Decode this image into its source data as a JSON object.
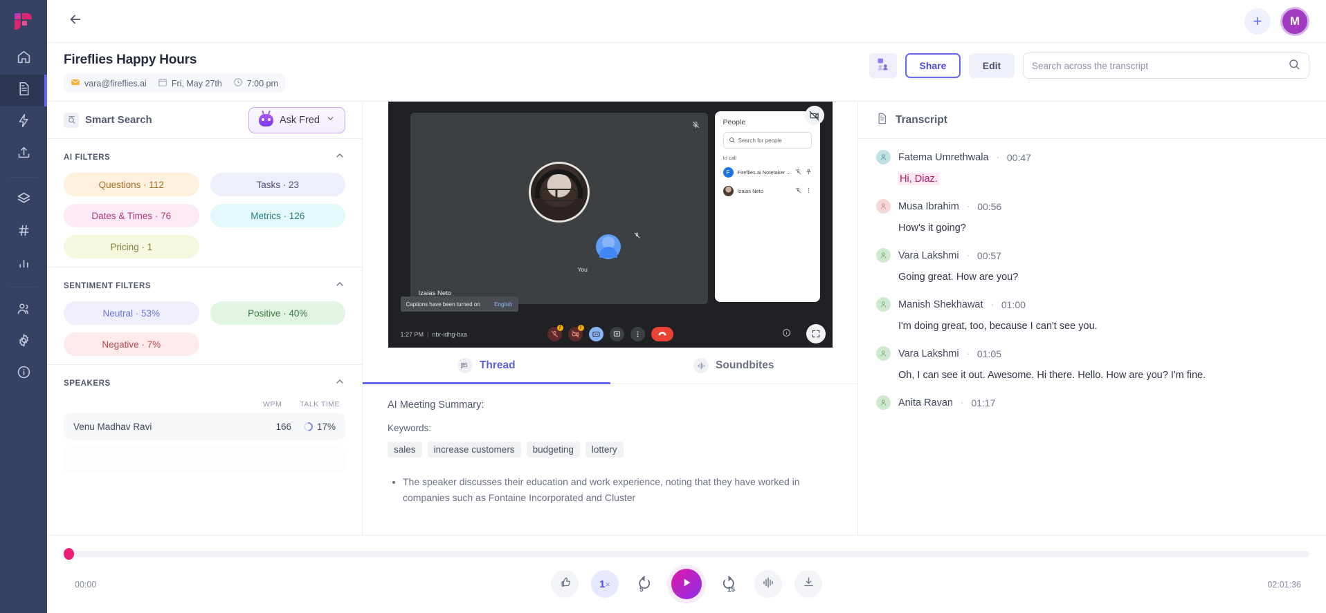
{
  "brand": {
    "logo_name": "fireflies-logo",
    "accent": "#6366f1",
    "pink": "#ec1e79"
  },
  "rail": {
    "items": [
      {
        "name": "home",
        "icon": "home-icon",
        "active": false
      },
      {
        "name": "notes",
        "icon": "document-icon",
        "active": true
      },
      {
        "name": "automation",
        "icon": "lightning-icon",
        "active": false
      },
      {
        "name": "upload",
        "icon": "upload-icon",
        "active": false
      },
      {
        "name": "channels",
        "icon": "layers-icon",
        "active": false
      },
      {
        "name": "topics",
        "icon": "hash-icon",
        "active": false
      },
      {
        "name": "analytics",
        "icon": "bar-chart-icon",
        "active": false
      },
      {
        "name": "teammates",
        "icon": "users-icon",
        "active": false
      },
      {
        "name": "settings",
        "icon": "gear-icon",
        "active": false
      },
      {
        "name": "help",
        "icon": "info-icon",
        "active": false
      }
    ]
  },
  "topbar": {
    "back_icon": "arrow-left-icon",
    "plus_label": "+",
    "avatar_initial": "M"
  },
  "meeting": {
    "title": "Fireflies Happy Hours",
    "organizer": "vara@fireflies.ai",
    "date": "Fri, May 27th",
    "time": "7:00 pm",
    "share_label": "Share",
    "edit_label": "Edit",
    "invite_icon": "add-participants-icon"
  },
  "search": {
    "placeholder": "Search across the transcript",
    "value": "",
    "icon": "search-icon"
  },
  "smart_search": {
    "label": "Smart Search",
    "icon": "smart-search-icon",
    "ask_fred_label": "Ask Fred",
    "chevron": "chevron-down-icon"
  },
  "ai_filters": {
    "title": "AI FILTERS",
    "collapsed": false,
    "chips": [
      {
        "label": "Questions · 112",
        "bg": "#fdf0dd",
        "fg": "#a8702a"
      },
      {
        "label": "Tasks · 23",
        "bg": "#eeeffc",
        "fg": "#4a5striped"
      },
      {
        "label": "Dates & Times · 76",
        "bg": "#fdeaf4",
        "fg": "#a93a7e"
      },
      {
        "label": "Metrics · 126",
        "bg": "#e3f8f8",
        "fg": "#2e7c80"
      },
      {
        "label": "Pricing · 1",
        "bg": "#f6f7df",
        "fg": "#7d7f3a"
      }
    ]
  },
  "sentiment_filters": {
    "title": "SENTIMENT FILTERS",
    "collapsed": false,
    "chips": [
      {
        "label": "Neutral · 53%",
        "bg": "#eeeefc",
        "fg": "#6f76d8"
      },
      {
        "label": "Positive · 40%",
        "bg": "#e2f4e4",
        "fg": "#3b7a43"
      },
      {
        "label": "Negative · 7%",
        "bg": "#fdeaea",
        "fg": "#b3484a"
      }
    ]
  },
  "speakers": {
    "title": "SPEAKERS",
    "collapsed": false,
    "col_wpm": "WPM",
    "col_talk": "TALK TIME",
    "rows": [
      {
        "name": "Venu Madhav Ravi",
        "wpm": "166",
        "talk": "17%"
      }
    ]
  },
  "video": {
    "participant_name": "Izaias Neto",
    "self_label": "You",
    "caption_text": "Captions have been turned on",
    "caption_lang": "English",
    "clock": "1:27 PM",
    "meeting_code": "nbr-idhg-bxa",
    "people_panel": {
      "title": "People",
      "search_placeholder": "Search for people",
      "section": "In call",
      "rows": [
        {
          "initial": "F",
          "name": "Fireflies.ai Notetaker ...  (You)",
          "type": "bot"
        },
        {
          "initial": "",
          "name": "Izaias Neto",
          "type": "person"
        }
      ]
    }
  },
  "tabs": [
    {
      "label": "Thread",
      "icon": "thread-icon",
      "active": true
    },
    {
      "label": "Soundbites",
      "icon": "soundbites-icon",
      "active": false
    }
  ],
  "thread": {
    "heading": "AI Meeting Summary:",
    "keywords_label": "Keywords:",
    "keywords": [
      "sales",
      "increase customers",
      "budgeting",
      "lottery"
    ],
    "bullets": [
      "The speaker discusses their education and work experience, noting that they have worked in companies such as Fontaine Incorporated and Cluster"
    ]
  },
  "transcript": {
    "title": "Transcript",
    "icon": "transcript-icon",
    "items": [
      {
        "speaker": "Fatema Umrethwala",
        "time": "00:47",
        "text": "Hi, Diaz.",
        "highlight": true,
        "av": "#bfe0e4"
      },
      {
        "speaker": "Musa Ibrahim",
        "time": "00:56",
        "text": "How's it going?",
        "highlight": false,
        "av": "#f6d7d7"
      },
      {
        "speaker": "Vara Lakshmi",
        "time": "00:57",
        "text": "Going great. How are you?",
        "highlight": false,
        "av": "#cfe9cf"
      },
      {
        "speaker": "Manish Shekhawat",
        "time": "01:00",
        "text": "I'm doing great, too, because I can't see you.",
        "highlight": false,
        "av": "#cfe9cf"
      },
      {
        "speaker": "Vara Lakshmi",
        "time": "01:05",
        "text": "Oh, I can see it out. Awesome. Hi there. Hello. How are you? I'm fine.",
        "highlight": false,
        "av": "#cfe9cf"
      },
      {
        "speaker": "Anita Ravan",
        "time": "01:17",
        "text": "",
        "highlight": false,
        "av": "#cfe9cf"
      }
    ]
  },
  "player": {
    "current_time": "00:00",
    "total_time": "02:01:36",
    "progress_percent": 0,
    "speed": "1",
    "speed_suffix": "×",
    "skip_back": "5",
    "skip_forward": "15",
    "buttons": [
      {
        "name": "reaction-button",
        "icon": "thumbs-up-plus-icon"
      },
      {
        "name": "speed-button",
        "icon": "speed-icon"
      },
      {
        "name": "rewind-button",
        "icon": "rewind-5-icon"
      },
      {
        "name": "play-button",
        "icon": "play-icon"
      },
      {
        "name": "forward-button",
        "icon": "forward-15-icon"
      },
      {
        "name": "waveform-button",
        "icon": "waveform-icon"
      },
      {
        "name": "download-button",
        "icon": "download-icon"
      }
    ]
  }
}
